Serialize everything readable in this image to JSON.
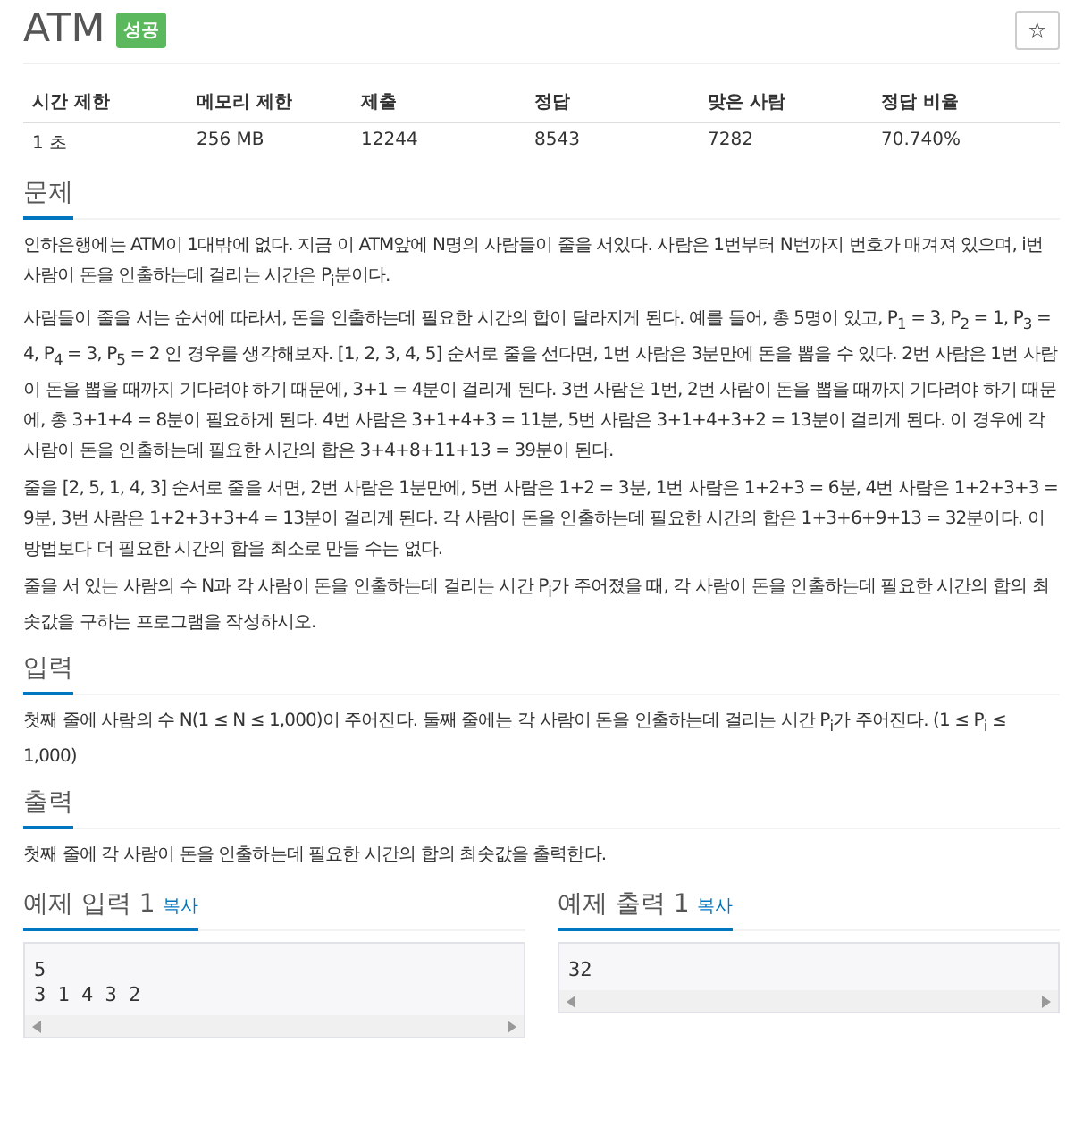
{
  "problem": {
    "title": "ATM",
    "badge": "성공",
    "star": "☆"
  },
  "stats": {
    "columns": [
      "시간 제한",
      "메모리 제한",
      "제출",
      "정답",
      "맞은 사람",
      "정답 비율"
    ],
    "values": [
      "1 초",
      "256 MB",
      "12244",
      "8543",
      "7282",
      "70.740%"
    ]
  },
  "sections": [
    {
      "heading": "문제",
      "paragraphs": [
        "인하은행에는 ATM이 1대밖에 없다. 지금 이 ATM앞에 N명의 사람들이 줄을 서있다. 사람은 1번부터 N번까지 번호가 매겨져 있으며, i번 사람이 돈을 인출하는데 걸리는 시간은 P$_{i}$분이다.",
        "사람들이 줄을 서는 순서에 따라서, 돈을 인출하는데 필요한 시간의 합이 달라지게 된다. 예를 들어, 총 5명이 있고, P$_{1}$ = 3, P$_{2}$ = 1, P$_{3}$ = 4, P$_{4}$ = 3, P$_{5}$ = 2 인 경우를 생각해보자. [1, 2, 3, 4, 5] 순서로 줄을 선다면, 1번 사람은 3분만에 돈을 뽑을 수 있다. 2번 사람은 1번 사람이 돈을 뽑을 때까지 기다려야 하기 때문에, 3+1 = 4분이 걸리게 된다. 3번 사람은 1번, 2번 사람이 돈을 뽑을 때까지 기다려야 하기 때문에, 총 3+1+4 = 8분이 필요하게 된다. 4번 사람은 3+1+4+3 = 11분, 5번 사람은 3+1+4+3+2 = 13분이 걸리게 된다. 이 경우에 각 사람이 돈을 인출하는데 필요한 시간의 합은 3+4+8+11+13 = 39분이 된다.",
        "줄을 [2, 5, 1, 4, 3] 순서로 줄을 서면, 2번 사람은 1분만에, 5번 사람은 1+2 = 3분, 1번 사람은 1+2+3 = 6분, 4번 사람은 1+2+3+3 = 9분, 3번 사람은 1+2+3+3+4 = 13분이 걸리게 된다. 각 사람이 돈을 인출하는데 필요한 시간의 합은 1+3+6+9+13 = 32분이다. 이 방법보다 더 필요한 시간의 합을 최소로 만들 수는 없다.",
        "줄을 서 있는 사람의 수 N과 각 사람이 돈을 인출하는데 걸리는 시간 P$_{i}$가 주어졌을 때, 각 사람이 돈을 인출하는데 필요한 시간의 합의 최솟값을 구하는 프로그램을 작성하시오."
      ]
    },
    {
      "heading": "입력",
      "paragraphs": [
        "첫째 줄에 사람의 수 N(1 ≤ N ≤ 1,000)이 주어진다. 둘째 줄에는 각 사람이 돈을 인출하는데 걸리는 시간 P$_{i}$가 주어진다. (1 ≤ P$_{i}$ ≤ 1,000)"
      ]
    },
    {
      "heading": "출력",
      "paragraphs": [
        "첫째 줄에 각 사람이 돈을 인출하는데 필요한 시간의 합의 최솟값을 출력한다."
      ]
    }
  ],
  "samples": [
    {
      "heading": "예제 입력 1",
      "copy": "복사",
      "lines": [
        "5",
        "3 1 4 3 2"
      ]
    },
    {
      "heading": "예제 출력 1",
      "copy": "복사",
      "lines": [
        "32"
      ]
    }
  ]
}
